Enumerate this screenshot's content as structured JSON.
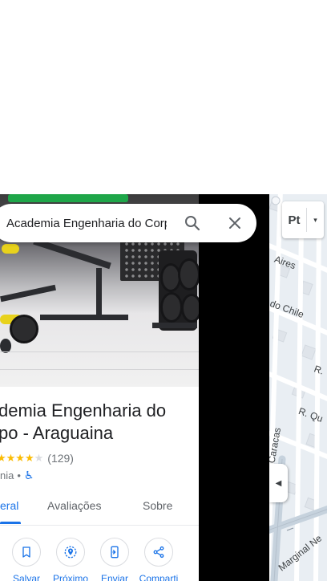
{
  "search": {
    "value": "Academia Engenharia do Corpo - Araguaina"
  },
  "place": {
    "title": "Academia Engenharia do Corpo - Araguaina",
    "title_line1": "demia Engenharia do",
    "title_line2": "po - Araguaina",
    "stars_filled": "★★★★",
    "stars_empty": "★",
    "rating": 4,
    "review_count": "(129)",
    "category": "nia",
    "separator": "•",
    "wheelchair_symbol": "♿"
  },
  "tabs": [
    {
      "label": "eral",
      "active": true
    },
    {
      "label": "Avaliações",
      "active": false
    },
    {
      "label": "Sobre",
      "active": false
    }
  ],
  "actions": [
    {
      "label": "Salvar",
      "icon": "bookmark-icon"
    },
    {
      "label": "Próximo",
      "icon": "nearby-icon"
    },
    {
      "label": "Enviar",
      "icon": "send-to-phone-icon"
    },
    {
      "label": "Comparti",
      "icon": "share-icon"
    }
  ],
  "map": {
    "layer_label": "Pt",
    "layer_caret": "▾",
    "collapse_symbol": "◀",
    "streets": {
      "aires": "Aires",
      "chile": "do Chile",
      "r1": "R.",
      "qu": "R. Qu",
      "caracas": "Caracas",
      "marginal": "Marginal Ne"
    }
  },
  "colors": {
    "accent": "#1a73e8",
    "star": "#fbbc04",
    "map_bg": "#e9eef3",
    "road": "#ffffff",
    "road_major": "#c6d2dd"
  }
}
